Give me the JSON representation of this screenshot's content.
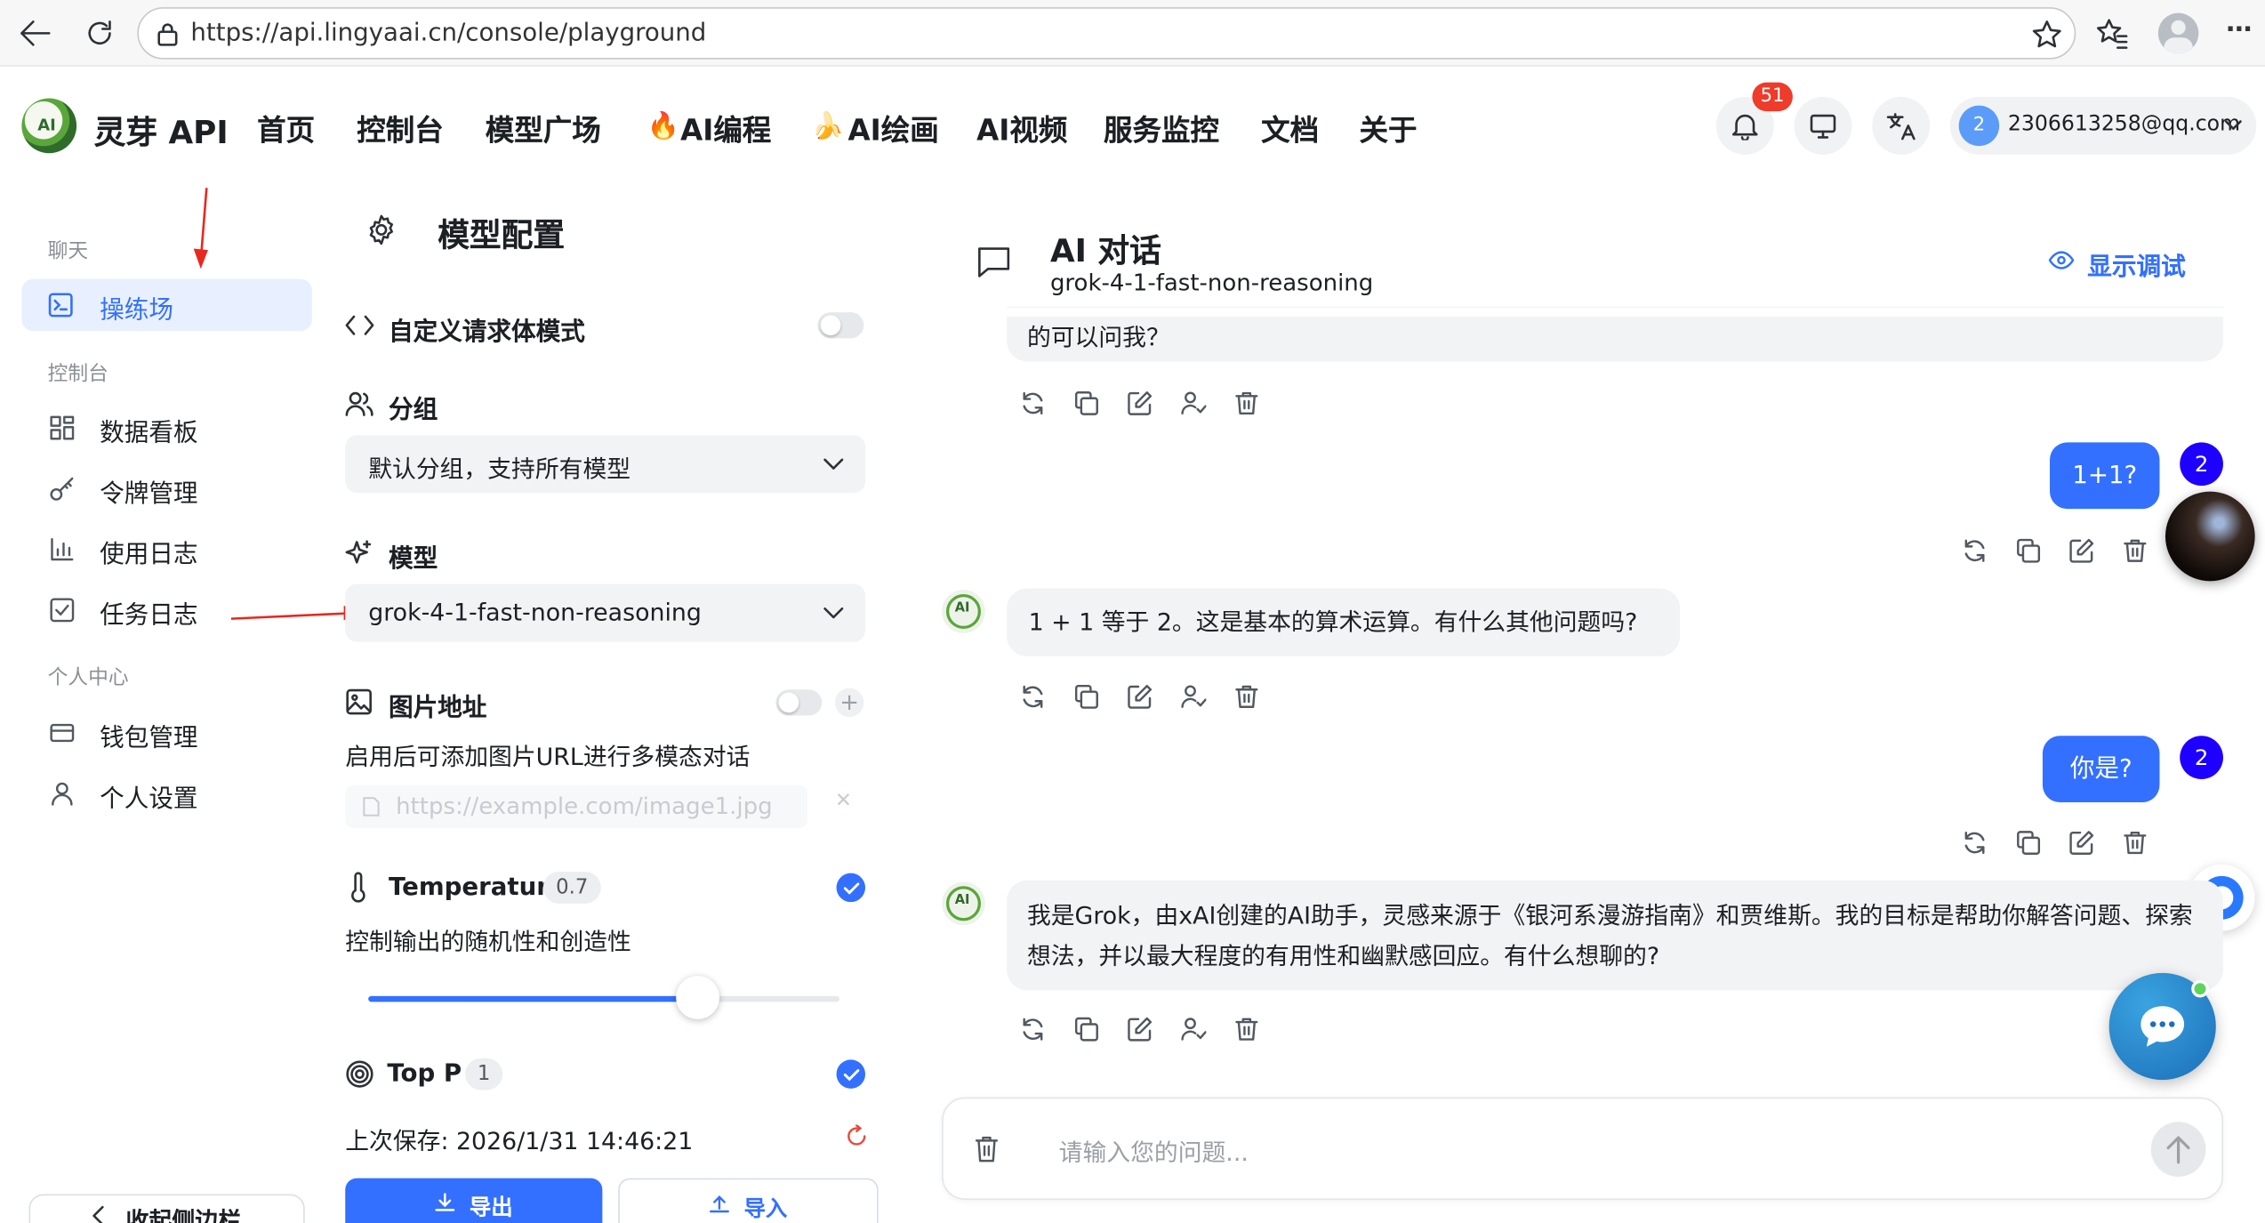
{
  "browser": {
    "url": "https://api.lingyaai.cn/console/playground"
  },
  "header": {
    "brand": "灵芽 API",
    "nav": [
      "首页",
      "控制台",
      "模型广场",
      "AI编程",
      "AI绘画",
      "AI视频",
      "服务监控",
      "文档",
      "关于"
    ],
    "notification_count": "51",
    "user_avatar": "2",
    "user_email": "2306613258@qq.com"
  },
  "sidebar": {
    "section_chat": "聊天",
    "playground": "操练场",
    "section_console": "控制台",
    "dashboard": "数据看板",
    "tokens": "令牌管理",
    "usage_logs": "使用日志",
    "task_logs": "任务日志",
    "section_personal": "个人中心",
    "wallet": "钱包管理",
    "settings": "个人设置",
    "collapse": "收起侧边栏"
  },
  "config": {
    "title": "模型配置",
    "custom_body_label": "自定义请求体模式",
    "group_label": "分组",
    "group_value": "默认分组，支持所有模型",
    "model_label": "模型",
    "model_value": "grok-4-1-fast-non-reasoning",
    "image_label": "图片地址",
    "image_desc": "启用后可添加图片URL进行多模态对话",
    "image_placeholder": "https://example.com/image1.jpg",
    "temperature_label": "Temperature",
    "temperature_value": "0.7",
    "temperature_fraction": 0.7,
    "temperature_desc": "控制输出的随机性和创造性",
    "top_p_label": "Top P",
    "top_p_value": "1",
    "last_saved": "上次保存: 2026/1/31 14:46:21",
    "export_label": "导出",
    "import_label": "导入"
  },
  "chat": {
    "title": "AI 对话",
    "model": "grok-4-1-fast-non-reasoning",
    "debug_toggle": "显示调试",
    "partial_message": "的可以问我？",
    "messages": [
      {
        "role": "user",
        "text": "1+1?",
        "avatar": "2"
      },
      {
        "role": "assistant",
        "text": "1 + 1 等于 2。这是基本的算术运算。有什么其他问题吗?"
      },
      {
        "role": "user",
        "text": "你是?",
        "avatar": "2"
      },
      {
        "role": "assistant",
        "text": "我是Grok，由xAI创建的AI助手，灵感来源于《银河系漫游指南》和贾维斯。我的目标是帮助你解答问题、探索想法，并以最大程度的有用性和幽默感回应。有什么想聊的?"
      }
    ],
    "input_placeholder": "请输入您的问题..."
  },
  "colors": {
    "accent": "#3370ff",
    "active_bg": "#e8f0ff",
    "badge": "#ee3b2a",
    "arrow": "#e8281e"
  }
}
